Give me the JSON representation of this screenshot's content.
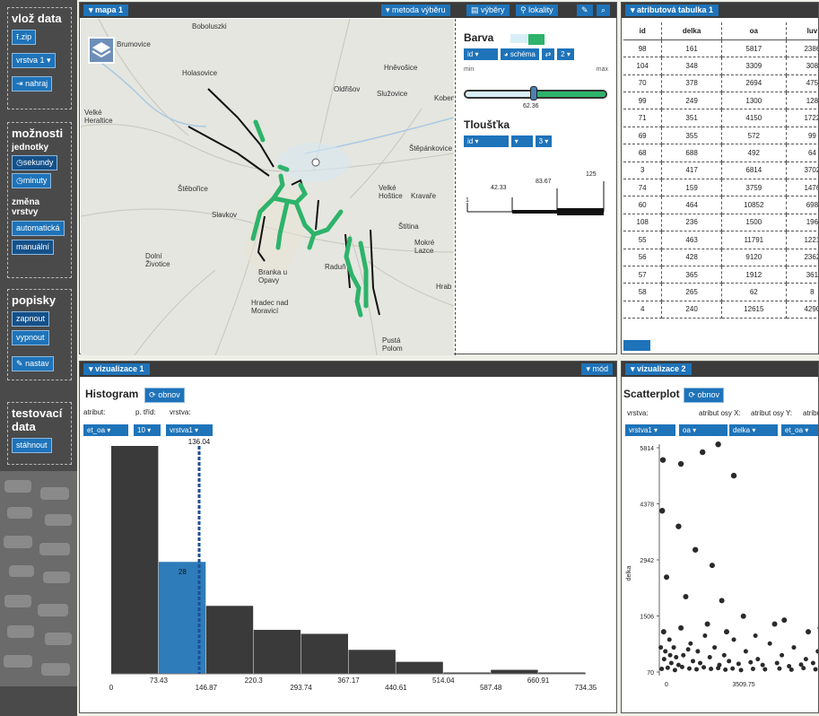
{
  "sidebar": {
    "upload_title": "vlož data",
    "zip_button": ".zip",
    "layer_select": "vrstva 1",
    "upload_button": "nahraj",
    "options_title": "možnosti",
    "units_label": "jednotky",
    "seconds_button": "sekundy",
    "minutes_button": "minuty",
    "change_layer_label": "změna vrstvy",
    "auto_button": "automatická",
    "manual_button": "manuální",
    "labels_title": "popisky",
    "on_button": "zapnout",
    "off_button": "vypnout",
    "settings_button": "nastav",
    "test_title": "testovací data",
    "download_button": "stáhnout"
  },
  "map_panel": {
    "title": "mapa 1",
    "selection_method": "metoda výběru",
    "selections": "výběry",
    "localities": "lokality",
    "places": [
      "Boboluszki",
      "Brumovice",
      "Holasovice",
      "Hněvošice",
      "Oldřišov",
      "Služovice",
      "Koben",
      "Velké Heraltice",
      "Štěpánkovice",
      "Štěbořice",
      "Velké Hoštice",
      "Kravaře",
      "Slavkov",
      "Štítina",
      "Mokré Lazce",
      "Dolní Životice",
      "Branka u Opavy",
      "Raduň",
      "Hrab",
      "Hradec nad Moravicí",
      "Pustá Polom"
    ],
    "colors": {
      "route_green": "#2db36a",
      "route_black": "#111111",
      "accent": "#1e73b9"
    }
  },
  "legend": {
    "color_label": "Barva",
    "attr_select": "id",
    "schema_button": "schéma",
    "classes_select": "2",
    "min_label": "min",
    "max_label": "max",
    "slider_value": "62.36",
    "thickness_label": "Tloušťka",
    "thickness_attr": "id",
    "thickness_classes": "3",
    "scale_values": [
      "42.33",
      "83.67",
      "125"
    ],
    "scale_start": "1"
  },
  "table": {
    "title": "atributová tabulka 1",
    "columns": [
      "id",
      "delka",
      "oa",
      "luv"
    ],
    "rows": [
      [
        "98",
        "161",
        "5817",
        "2386"
      ],
      [
        "104",
        "348",
        "3309",
        "308"
      ],
      [
        "70",
        "378",
        "2694",
        "475"
      ],
      [
        "99",
        "249",
        "1300",
        "128"
      ],
      [
        "71",
        "351",
        "4150",
        "1722"
      ],
      [
        "69",
        "355",
        "572",
        "99"
      ],
      [
        "68",
        "688",
        "492",
        "64"
      ],
      [
        "3",
        "417",
        "6814",
        "3702"
      ],
      [
        "74",
        "159",
        "3759",
        "1476"
      ],
      [
        "60",
        "464",
        "10852",
        "698"
      ],
      [
        "108",
        "236",
        "1500",
        "196"
      ],
      [
        "55",
        "463",
        "11791",
        "1221"
      ],
      [
        "56",
        "428",
        "9120",
        "2362"
      ],
      [
        "57",
        "365",
        "1912",
        "361"
      ],
      [
        "58",
        "265",
        "62",
        "8"
      ],
      [
        "4",
        "240",
        "12615",
        "4290"
      ]
    ]
  },
  "viz1": {
    "title": "vizualizace 1",
    "mode_button": "mód",
    "heading": "Histogram",
    "refresh": "obnov",
    "attr_label": "atribut:",
    "classes_label": "p. tříd:",
    "layer_label": "vrstva:",
    "attr_value": "et_oa",
    "classes_value": "10",
    "layer_value": "vrstva1",
    "marker_value": "136.04",
    "highlight_count": "28"
  },
  "viz2": {
    "title": "vizualizace 2",
    "heading": "Scatterplot",
    "refresh": "obnov",
    "layer_label": "vrstva:",
    "x_label": "atribut osy X:",
    "y_label": "atribut osy Y:",
    "extra_label": "atribu",
    "layer_value": "vrstva1",
    "x_value": "oa",
    "y_value": "delka",
    "extra_value": "et_oa",
    "y_axis_title": "delka"
  },
  "chart_data": [
    {
      "type": "bar",
      "title": "Histogram",
      "x_ticks": [
        "0",
        "73.43",
        "146.87",
        "220.3",
        "293.74",
        "367.17",
        "440.61",
        "514.04",
        "587.48",
        "660.91",
        "734.35"
      ],
      "bins": [
        [
          0,
          73.43
        ],
        [
          73.43,
          146.87
        ],
        [
          146.87,
          220.3
        ],
        [
          220.3,
          293.74
        ],
        [
          293.74,
          367.17
        ],
        [
          367.17,
          440.61
        ],
        [
          440.61,
          514.04
        ],
        [
          514.04,
          587.48
        ],
        [
          587.48,
          660.91
        ],
        [
          660.91,
          734.35
        ]
      ],
      "values": [
        57,
        28,
        17,
        11,
        10,
        6,
        3,
        0,
        1,
        0
      ],
      "highlight_bin": 1,
      "marker_x": 136.04
    },
    {
      "type": "scatter",
      "title": "Scatterplot",
      "xlabel": "",
      "ylabel": "delka",
      "y_ticks": [
        "5814",
        "4378",
        "2942",
        "1506",
        "70"
      ],
      "x_ticks": [
        "0",
        "3509.75"
      ],
      "ylim": [
        70,
        5814
      ],
      "xlim": [
        0,
        7019.5
      ],
      "points": [
        [
          150,
          5500
        ],
        [
          900,
          5400
        ],
        [
          1800,
          5700
        ],
        [
          2450,
          5900
        ],
        [
          3100,
          5100
        ],
        [
          120,
          4200
        ],
        [
          800,
          3800
        ],
        [
          1500,
          3200
        ],
        [
          2200,
          2800
        ],
        [
          300,
          2500
        ],
        [
          1100,
          2000
        ],
        [
          2600,
          1900
        ],
        [
          3500,
          1500
        ],
        [
          4800,
          1300
        ],
        [
          6200,
          1100
        ],
        [
          6900,
          900
        ],
        [
          180,
          1100
        ],
        [
          420,
          900
        ],
        [
          600,
          700
        ],
        [
          900,
          1200
        ],
        [
          1300,
          800
        ],
        [
          1600,
          600
        ],
        [
          1900,
          1000
        ],
        [
          2300,
          700
        ],
        [
          2700,
          500
        ],
        [
          3100,
          900
        ],
        [
          3600,
          600
        ],
        [
          4100,
          400
        ],
        [
          4600,
          800
        ],
        [
          5100,
          500
        ],
        [
          5600,
          700
        ],
        [
          6100,
          400
        ],
        [
          6600,
          600
        ],
        [
          200,
          400
        ],
        [
          500,
          300
        ],
        [
          800,
          250
        ],
        [
          1000,
          500
        ],
        [
          1400,
          350
        ],
        [
          1700,
          300
        ],
        [
          2100,
          450
        ],
        [
          2500,
          250
        ],
        [
          2900,
          350
        ],
        [
          3300,
          280
        ],
        [
          3800,
          320
        ],
        [
          4300,
          250
        ],
        [
          4900,
          300
        ],
        [
          5400,
          220
        ],
        [
          5900,
          260
        ],
        [
          6400,
          300
        ],
        [
          100,
          150
        ],
        [
          350,
          180
        ],
        [
          650,
          120
        ],
        [
          950,
          200
        ],
        [
          1250,
          160
        ],
        [
          1550,
          140
        ],
        [
          1850,
          190
        ],
        [
          2150,
          150
        ],
        [
          2450,
          170
        ],
        [
          2750,
          130
        ],
        [
          3050,
          160
        ],
        [
          3400,
          120
        ],
        [
          3900,
          150
        ],
        [
          4400,
          140
        ],
        [
          5000,
          160
        ],
        [
          5500,
          130
        ],
        [
          6000,
          170
        ],
        [
          6500,
          140
        ],
        [
          6900,
          120
        ],
        [
          60,
          700
        ],
        [
          250,
          600
        ],
        [
          450,
          500
        ],
        [
          700,
          450
        ],
        [
          1200,
          650
        ],
        [
          2000,
          1300
        ],
        [
          2800,
          1100
        ],
        [
          4000,
          1000
        ],
        [
          5200,
          1400
        ],
        [
          6700,
          1200
        ]
      ]
    }
  ]
}
